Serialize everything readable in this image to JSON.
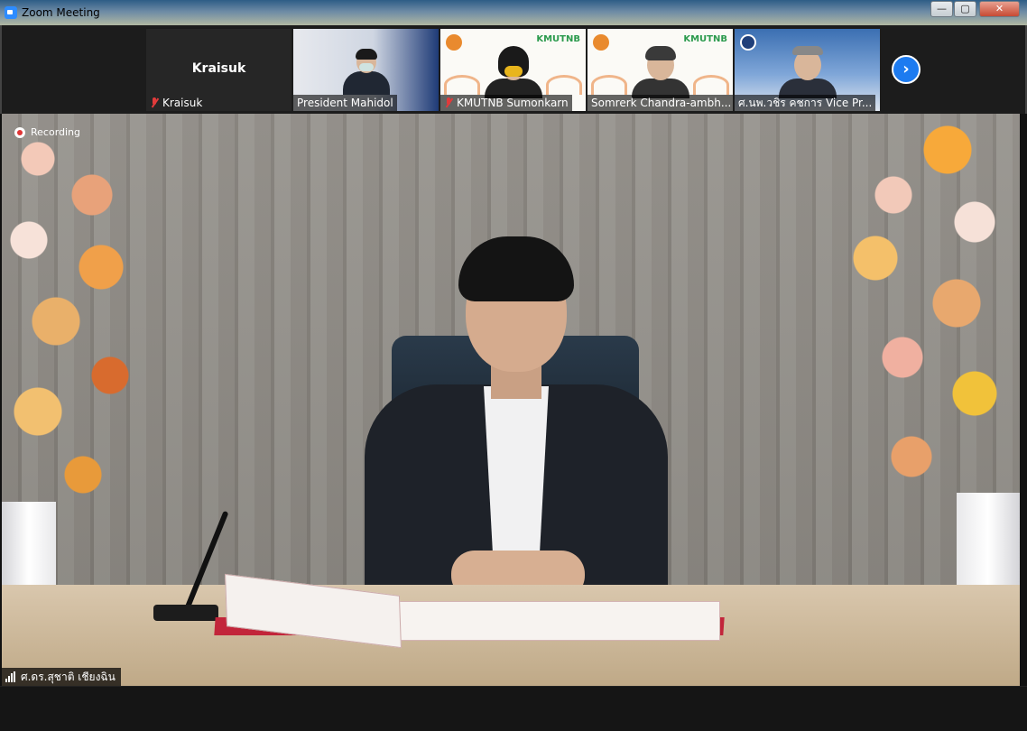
{
  "window": {
    "title": "Zoom Meeting",
    "controls": {
      "minimize": "—",
      "maximize": "▢",
      "close": "✕"
    }
  },
  "gallery": {
    "self": {
      "big_name": "Kraisuk",
      "label": "Kraisuk",
      "muted": true
    },
    "tiles": [
      {
        "label": "President Mahidol",
        "muted": false
      },
      {
        "label": "KMUTNB Sumonkarn",
        "muted": true,
        "logo": "KMUTNB"
      },
      {
        "label": "Somrerk Chandra-ambh...",
        "muted": false,
        "logo": "KMUTNB"
      },
      {
        "label": "ศ.นพ.วชิร คชการ Vice Pr...",
        "muted": false
      }
    ],
    "next_icon": "›"
  },
  "main": {
    "recording_label": "Recording",
    "speaker_name": "ศ.ดร.สุชาติ เชียงฉิน"
  },
  "colors": {
    "zoom_blue": "#1d7bf0",
    "recording_red": "#e03535",
    "muted_red": "#e23b3b"
  }
}
